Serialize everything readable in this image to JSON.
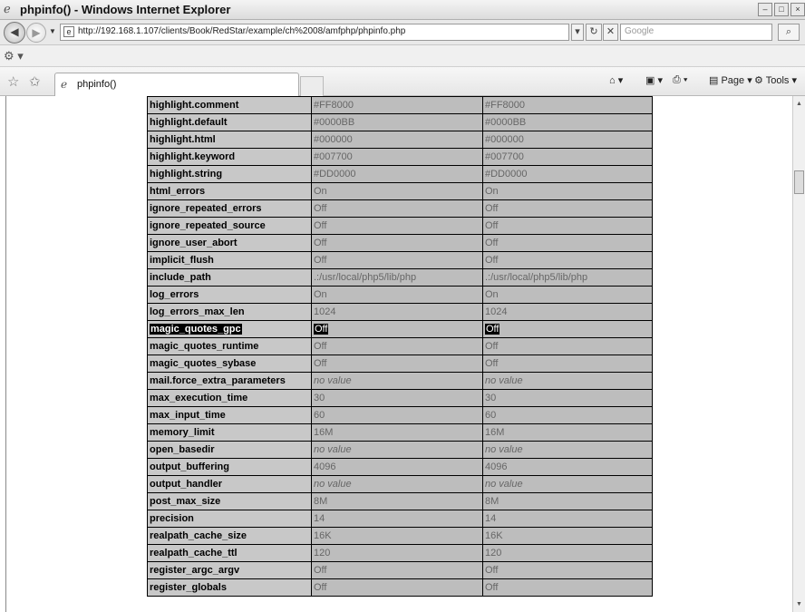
{
  "window": {
    "title": "phpinfo() - Windows Internet Explorer"
  },
  "toolbar": {
    "url": "http://192.168.1.107/clients/Book/RedStar/example/ch%2008/amfphp/phpinfo.php",
    "search_placeholder": "Google"
  },
  "tab": {
    "label": "phpinfo()"
  },
  "commands": {
    "page_label": "Page",
    "tools_label": "Tools"
  },
  "rows": [
    {
      "name": "highlight.comment",
      "local": "#FF8000",
      "master": "#FF8000"
    },
    {
      "name": "highlight.default",
      "local": "#0000BB",
      "master": "#0000BB"
    },
    {
      "name": "highlight.html",
      "local": "#000000",
      "master": "#000000"
    },
    {
      "name": "highlight.keyword",
      "local": "#007700",
      "master": "#007700"
    },
    {
      "name": "highlight.string",
      "local": "#DD0000",
      "master": "#DD0000"
    },
    {
      "name": "html_errors",
      "local": "On",
      "master": "On"
    },
    {
      "name": "ignore_repeated_errors",
      "local": "Off",
      "master": "Off"
    },
    {
      "name": "ignore_repeated_source",
      "local": "Off",
      "master": "Off"
    },
    {
      "name": "ignore_user_abort",
      "local": "Off",
      "master": "Off"
    },
    {
      "name": "implicit_flush",
      "local": "Off",
      "master": "Off"
    },
    {
      "name": "include_path",
      "local": ".:/usr/local/php5/lib/php",
      "master": ".:/usr/local/php5/lib/php"
    },
    {
      "name": "log_errors",
      "local": "On",
      "master": "On"
    },
    {
      "name": "log_errors_max_len",
      "local": "1024",
      "master": "1024"
    },
    {
      "name": "magic_quotes_gpc",
      "local": "Off",
      "master": "Off"
    },
    {
      "name": "magic_quotes_runtime",
      "local": "Off",
      "master": "Off"
    },
    {
      "name": "magic_quotes_sybase",
      "local": "Off",
      "master": "Off"
    },
    {
      "name": "mail.force_extra_parameters",
      "local": "no value",
      "master": "no value"
    },
    {
      "name": "max_execution_time",
      "local": "30",
      "master": "30"
    },
    {
      "name": "max_input_time",
      "local": "60",
      "master": "60"
    },
    {
      "name": "memory_limit",
      "local": "16M",
      "master": "16M"
    },
    {
      "name": "open_basedir",
      "local": "no value",
      "master": "no value"
    },
    {
      "name": "output_buffering",
      "local": "4096",
      "master": "4096"
    },
    {
      "name": "output_handler",
      "local": "no value",
      "master": "no value"
    },
    {
      "name": "post_max_size",
      "local": "8M",
      "master": "8M"
    },
    {
      "name": "precision",
      "local": "14",
      "master": "14"
    },
    {
      "name": "realpath_cache_size",
      "local": "16K",
      "master": "16K"
    },
    {
      "name": "realpath_cache_ttl",
      "local": "120",
      "master": "120"
    },
    {
      "name": "register_argc_argv",
      "local": "Off",
      "master": "Off"
    },
    {
      "name": "register_globals",
      "local": "Off",
      "master": "Off"
    }
  ],
  "highlighted_row": "magic_quotes_gpc",
  "colors": {
    "cell_key": "#c8c8c8",
    "cell_value": "#bdbdbd",
    "grid": "#000000"
  }
}
